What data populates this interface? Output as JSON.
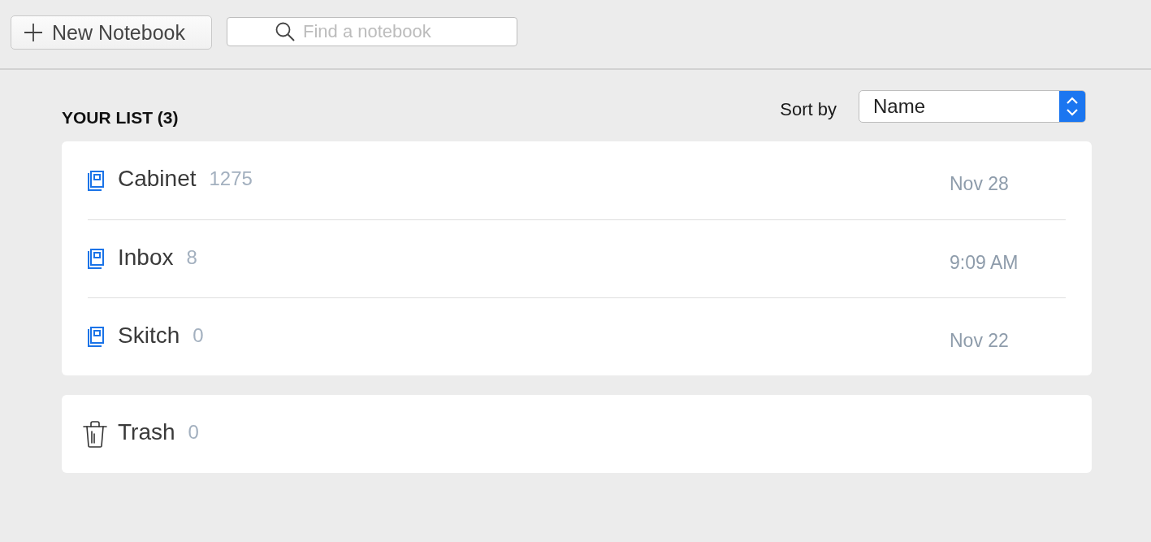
{
  "toolbar": {
    "new_button": {
      "label": "New Notebook"
    },
    "search": {
      "placeholder": "Find a notebook"
    }
  },
  "list": {
    "title": "YOUR LIST (3)",
    "sort": {
      "label": "Sort by",
      "value": "Name"
    },
    "notebooks": [
      {
        "name": "Cabinet",
        "count": "1275",
        "date": "Nov 28"
      },
      {
        "name": "Inbox",
        "count": "8",
        "date": "9:09 AM"
      },
      {
        "name": "Skitch",
        "count": "0",
        "date": "Nov 22"
      }
    ]
  },
  "trash": {
    "name": "Trash",
    "count": "0"
  }
}
